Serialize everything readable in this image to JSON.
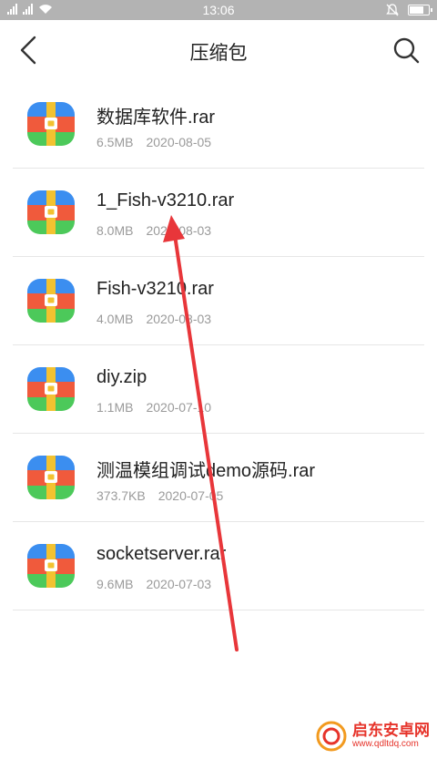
{
  "status_bar": {
    "time": "13:06",
    "battery_level": 0.8
  },
  "header": {
    "title": "压缩包",
    "back_icon": "back-chevron-icon",
    "search_icon": "search-icon"
  },
  "files": [
    {
      "name": "数据库软件.rar",
      "size": "6.5MB",
      "date": "2020-08-05"
    },
    {
      "name": "1_Fish-v3210.rar",
      "size": "8.0MB",
      "date": "2020-08-03"
    },
    {
      "name": "Fish-v3210.rar",
      "size": "4.0MB",
      "date": "2020-08-03"
    },
    {
      "name": "diy.zip",
      "size": "1.1MB",
      "date": "2020-07-10"
    },
    {
      "name": "测温模组调试demo源码.rar",
      "size": "373.7KB",
      "date": "2020-07-05"
    },
    {
      "name": "socketserver.rar",
      "size": "9.6MB",
      "date": "2020-07-03"
    }
  ],
  "watermark": {
    "name": "启东安卓网",
    "url": "www.qdltdq.com"
  },
  "colors": {
    "archive_blue": "#3b8ef0",
    "archive_red": "#f05a3c",
    "archive_green": "#4cc95a",
    "strap": "#f2c230",
    "annotation_arrow": "#e8363a"
  }
}
